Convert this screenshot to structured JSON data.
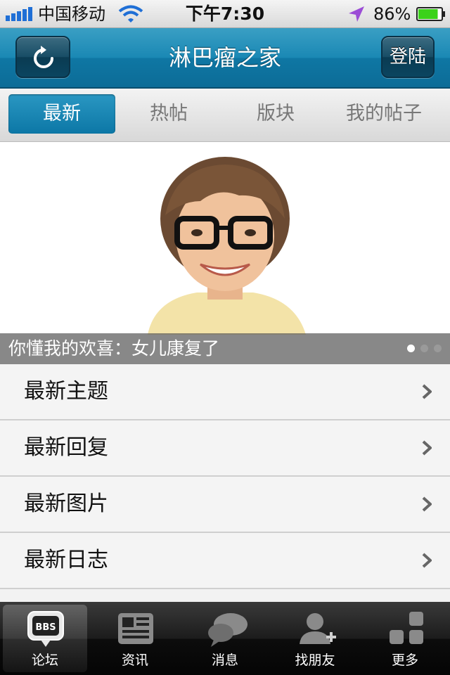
{
  "status_bar": {
    "carrier": "中国移动",
    "time": "下午7:30",
    "battery_percent": "86%",
    "battery_level": 0.86,
    "icons": [
      "signal-icon",
      "wifi-icon",
      "location-arrow-icon",
      "battery-icon"
    ]
  },
  "nav": {
    "title": "淋巴瘤之家",
    "login_label": "登陆",
    "refresh_icon": "refresh-icon"
  },
  "tabs": [
    {
      "label": "最新",
      "active": true
    },
    {
      "label": "热帖",
      "active": false
    },
    {
      "label": "版块",
      "active": false
    },
    {
      "label": "我的帖子",
      "active": false
    }
  ],
  "banner": {
    "caption": "你懂我的欢喜：女儿康复了",
    "page_count": 3,
    "current_page": 1
  },
  "list": [
    {
      "label": "最新主题"
    },
    {
      "label": "最新回复"
    },
    {
      "label": "最新图片"
    },
    {
      "label": "最新日志"
    }
  ],
  "tabbar": [
    {
      "label": "论坛",
      "icon": "bbs-icon",
      "badge": "BBS",
      "active": true
    },
    {
      "label": "资讯",
      "icon": "news-icon",
      "active": false
    },
    {
      "label": "消息",
      "icon": "chat-bubbles-icon",
      "active": false
    },
    {
      "label": "找朋友",
      "icon": "add-friend-icon",
      "active": false
    },
    {
      "label": "更多",
      "icon": "more-grid-icon",
      "active": false
    }
  ],
  "colors": {
    "nav_blue": "#1a88b4",
    "tab_active": "#0c77a6",
    "battery_green": "#3bd21a",
    "location_purple": "#9b4dd6"
  }
}
